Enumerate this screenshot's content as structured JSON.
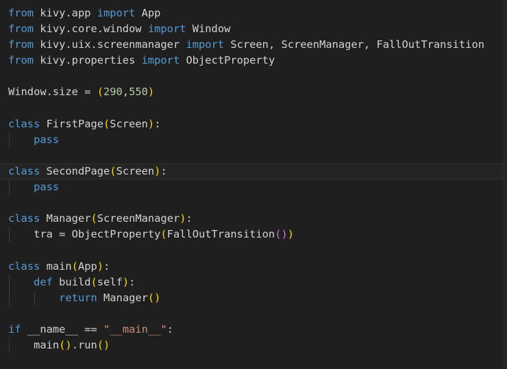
{
  "app": {
    "kind": "code-editor",
    "language": "python"
  },
  "colors": {
    "background": "#1f1f1f",
    "kw": "#569cd6",
    "txt": "#d4d4d4",
    "num": "#b5cea8",
    "str": "#ce9178",
    "b1": "#ffd700",
    "b2": "#da70d6",
    "indent_guide": "#3b3b3b",
    "current_line_border": "#333333",
    "current_line_bg": "#242424"
  },
  "editor": {
    "lines": [
      {
        "tokens": [
          {
            "c": "kw",
            "t": "from"
          },
          {
            "c": "txt",
            "t": " kivy.app "
          },
          {
            "c": "kw",
            "t": "import"
          },
          {
            "c": "txt",
            "t": " App"
          }
        ]
      },
      {
        "tokens": [
          {
            "c": "kw",
            "t": "from"
          },
          {
            "c": "txt",
            "t": " kivy.core.window "
          },
          {
            "c": "kw",
            "t": "import"
          },
          {
            "c": "txt",
            "t": " Window"
          }
        ]
      },
      {
        "tokens": [
          {
            "c": "kw",
            "t": "from"
          },
          {
            "c": "txt",
            "t": " kivy.uix.screenmanager "
          },
          {
            "c": "kw",
            "t": "import"
          },
          {
            "c": "txt",
            "t": " Screen, ScreenManager, FallOutTransition"
          }
        ]
      },
      {
        "tokens": [
          {
            "c": "kw",
            "t": "from"
          },
          {
            "c": "txt",
            "t": " kivy.properties "
          },
          {
            "c": "kw",
            "t": "import"
          },
          {
            "c": "txt",
            "t": " ObjectProperty"
          }
        ]
      },
      {
        "tokens": []
      },
      {
        "tokens": [
          {
            "c": "txt",
            "t": "Window.size = "
          },
          {
            "c": "b1",
            "t": "("
          },
          {
            "c": "num",
            "t": "290"
          },
          {
            "c": "txt",
            "t": ","
          },
          {
            "c": "num",
            "t": "550"
          },
          {
            "c": "b1",
            "t": ")"
          }
        ]
      },
      {
        "tokens": []
      },
      {
        "tokens": [
          {
            "c": "kw",
            "t": "class"
          },
          {
            "c": "txt",
            "t": " FirstPage"
          },
          {
            "c": "b1",
            "t": "("
          },
          {
            "c": "txt",
            "t": "Screen"
          },
          {
            "c": "b1",
            "t": ")"
          },
          {
            "c": "txt",
            "t": ":"
          }
        ]
      },
      {
        "guides": [
          0
        ],
        "tokens": [
          {
            "c": "txt",
            "t": "    "
          },
          {
            "c": "kw",
            "t": "pass"
          }
        ]
      },
      {
        "tokens": []
      },
      {
        "current": true,
        "tokens": [
          {
            "c": "kw",
            "t": "class"
          },
          {
            "c": "txt",
            "t": " SecondPage"
          },
          {
            "c": "b1",
            "t": "("
          },
          {
            "c": "txt",
            "t": "Screen"
          },
          {
            "c": "b1",
            "t": ")"
          },
          {
            "c": "txt",
            "t": ":"
          }
        ]
      },
      {
        "guides": [
          0
        ],
        "tokens": [
          {
            "c": "txt",
            "t": "    "
          },
          {
            "c": "kw",
            "t": "pass"
          }
        ]
      },
      {
        "tokens": []
      },
      {
        "tokens": [
          {
            "c": "kw",
            "t": "class"
          },
          {
            "c": "txt",
            "t": " Manager"
          },
          {
            "c": "b1",
            "t": "("
          },
          {
            "c": "txt",
            "t": "ScreenManager"
          },
          {
            "c": "b1",
            "t": ")"
          },
          {
            "c": "txt",
            "t": ":"
          }
        ]
      },
      {
        "guides": [
          0
        ],
        "tokens": [
          {
            "c": "txt",
            "t": "    tra = ObjectProperty"
          },
          {
            "c": "b1",
            "t": "("
          },
          {
            "c": "txt",
            "t": "FallOutTransition"
          },
          {
            "c": "b2",
            "t": "()"
          },
          {
            "c": "b1",
            "t": ")"
          }
        ]
      },
      {
        "tokens": []
      },
      {
        "tokens": [
          {
            "c": "kw",
            "t": "class"
          },
          {
            "c": "txt",
            "t": " main"
          },
          {
            "c": "b1",
            "t": "("
          },
          {
            "c": "txt",
            "t": "App"
          },
          {
            "c": "b1",
            "t": ")"
          },
          {
            "c": "txt",
            "t": ":"
          }
        ]
      },
      {
        "guides": [
          0
        ],
        "tokens": [
          {
            "c": "txt",
            "t": "    "
          },
          {
            "c": "kw",
            "t": "def"
          },
          {
            "c": "txt",
            "t": " build"
          },
          {
            "c": "b1",
            "t": "("
          },
          {
            "c": "txt",
            "t": "self"
          },
          {
            "c": "b1",
            "t": ")"
          },
          {
            "c": "txt",
            "t": ":"
          }
        ]
      },
      {
        "guides": [
          0,
          4
        ],
        "tokens": [
          {
            "c": "txt",
            "t": "        "
          },
          {
            "c": "kw",
            "t": "return"
          },
          {
            "c": "txt",
            "t": " Manager"
          },
          {
            "c": "b1",
            "t": "()"
          }
        ]
      },
      {
        "tokens": []
      },
      {
        "tokens": [
          {
            "c": "kw",
            "t": "if"
          },
          {
            "c": "txt",
            "t": " __name__ == "
          },
          {
            "c": "str",
            "t": "\"__main__\""
          },
          {
            "c": "txt",
            "t": ":"
          }
        ]
      },
      {
        "guides": [
          0
        ],
        "tokens": [
          {
            "c": "txt",
            "t": "    main"
          },
          {
            "c": "b1",
            "t": "()"
          },
          {
            "c": "txt",
            "t": ".run"
          },
          {
            "c": "b1",
            "t": "()"
          }
        ]
      },
      {
        "tokens": []
      }
    ]
  }
}
